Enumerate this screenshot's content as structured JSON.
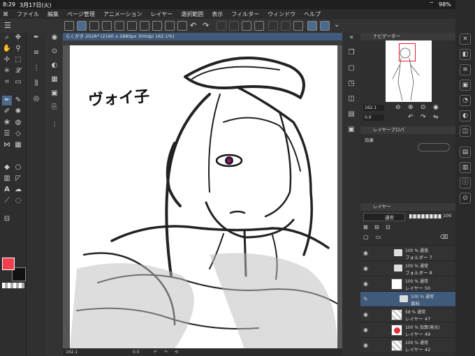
{
  "status": {
    "time": "8:29",
    "date": "3月17日(火)",
    "battery": "98%"
  },
  "menu": [
    "ファイル",
    "編集",
    "ページ管理",
    "アニメーション",
    "レイヤー",
    "選択範囲",
    "表示",
    "フィルター",
    "ウィンドウ",
    "ヘルプ"
  ],
  "document": {
    "tab_title": "らくがき 2026* (2160 x 2880px 300dpi 162.1%)",
    "canvas_text": "ヴォイ子"
  },
  "canvas_bottom": {
    "zoom": "162.1",
    "angle": "0.0"
  },
  "navigator": {
    "title": "ナビゲーター",
    "zoom": "162.1",
    "angle": "0.0"
  },
  "layer_property": {
    "title": "レイヤープロパ",
    "effect_label": "効果"
  },
  "layers_panel": {
    "title": "レイヤー",
    "blend_mode": "通常",
    "opacity": "100",
    "rows": [
      {
        "l1": "100 % 通過",
        "l2": "フォルダー 7",
        "kind": "folder",
        "selected": false
      },
      {
        "l1": "100 % 通常",
        "l2": "フォルダー 8",
        "kind": "folder",
        "selected": false
      },
      {
        "l1": "100 % 通常",
        "l2": "レイヤー 50",
        "kind": "sketch",
        "selected": false
      },
      {
        "l1": "100 % 通常",
        "l2": "資料",
        "kind": "folder",
        "selected": true
      },
      {
        "l1": "58 % 通常",
        "l2": "レイヤー 47",
        "kind": "layer",
        "selected": false
      },
      {
        "l1": "100 % 加算(発光)",
        "l2": "レイヤー 49",
        "kind": "red",
        "selected": false
      },
      {
        "l1": "100 % 通常",
        "l2": "レイヤー 42",
        "kind": "layer",
        "selected": false
      }
    ]
  },
  "colors": {
    "foreground": "#f04050",
    "background": "#111111",
    "accent": "#3f5a7a"
  }
}
